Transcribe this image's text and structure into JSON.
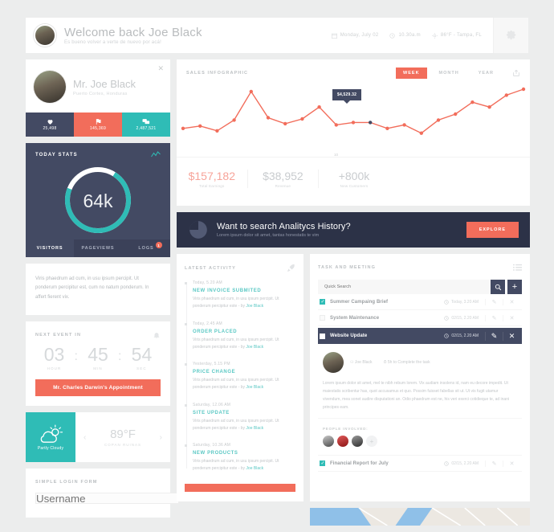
{
  "header": {
    "greeting": "Welcome back Joe Black",
    "subtitle": "Es bueno volver a verte de nuevo por acá!",
    "date": "Monday, July 02",
    "time": "10.30a.m",
    "weather": "86°F - Tampa, FL",
    "settings_icon": "gear-icon"
  },
  "profile": {
    "name": "Mr. Joe Black",
    "location": "Puerto Cortes, Honduras",
    "close_label": "✕",
    "stats": [
      {
        "icon": "heart-icon",
        "value": "25,498",
        "color": "#434a63"
      },
      {
        "icon": "flag-icon",
        "value": "145,369",
        "color": "#f26d5b"
      },
      {
        "icon": "comments-icon",
        "value": "2,487,521",
        "color": "#2fbcb6"
      }
    ]
  },
  "today_stats": {
    "title": "TODAY STATS",
    "chart_icon": "trend-line-icon",
    "donut_value": "64k",
    "donut_percent": 72,
    "donut_color": "#2fbcb6",
    "donut_track": "#ffffff",
    "tabs": [
      {
        "label": "VISITORS",
        "active": true,
        "badge": ""
      },
      {
        "label": "PAGEVIEWS",
        "active": false,
        "badge": ""
      },
      {
        "label": "LOGS",
        "active": false,
        "badge": "1"
      }
    ]
  },
  "description": {
    "text": "Viris phaedrum ad cum, in usu ipsum percipit. Ut ponderum percipitur est, cum no natum ponderum. In affert fierent vix."
  },
  "next_event": {
    "title": "NEXT EVENT IN",
    "icon": "bell-icon",
    "hours": "03",
    "minutes": "45",
    "seconds": "54",
    "separator": ":",
    "labels": {
      "hour": "HOUR",
      "min": "MIN",
      "sec": "SEC"
    },
    "button": "Mr. Charles Darwin's Appointment"
  },
  "weather_widget": {
    "icon": "partly-cloudy-icon",
    "condition": "Partly Cloudy",
    "temperature": "89°F",
    "city": "COPAN RUINAS",
    "prev": "‹",
    "next": "›"
  },
  "login_form": {
    "title": "SIMPLE LOGIN FORM",
    "placeholder": "Username"
  },
  "sales": {
    "title": "SALES INFOGRAPHIC",
    "share_icon": "share-icon",
    "ranges": [
      {
        "label": "WEEK",
        "active": true
      },
      {
        "label": "MONTH",
        "active": false
      },
      {
        "label": "YEAR",
        "active": false
      }
    ],
    "tooltip": "$4,529.32",
    "axis_label": "10",
    "figures": [
      {
        "value": "$157,182",
        "label": "Total Earnings",
        "accent": true
      },
      {
        "value": "$38,952",
        "label": "Revenue",
        "accent": false
      },
      {
        "value": "+800k",
        "label": "New Customers",
        "accent": false
      }
    ]
  },
  "chart_data": {
    "type": "line",
    "title": "SALES INFOGRAPHIC",
    "xlabel": "",
    "ylabel": "",
    "grid": false,
    "legend": "none",
    "series_color": "#f26d5b",
    "highlight_index": 11,
    "highlight_value": "$4,529.32",
    "ylim": [
      0,
      100
    ],
    "x": [
      0,
      1,
      2,
      3,
      4,
      5,
      6,
      7,
      8,
      9,
      10,
      11,
      12,
      13,
      14,
      15,
      16,
      17,
      18,
      19,
      20
    ],
    "values": [
      30,
      34,
      26,
      44,
      92,
      48,
      38,
      46,
      66,
      36,
      40,
      40,
      30,
      36,
      22,
      44,
      54,
      74,
      66,
      86,
      96
    ]
  },
  "banner": {
    "icon": "pie-chart-icon",
    "title": "Want to search Analitycs History?",
    "subtitle": "Lorem ipsum dolor sit amet, tantas honestatis te vim",
    "button": "EXPLORE"
  },
  "activity": {
    "title": "LATEST ACTIVITY",
    "icon": "rocket-icon",
    "items": [
      {
        "time": "Today, 5.20 AM",
        "name": "NEW INVOICE SUBMITED",
        "text": "Viris phaedrum ad cum, in usu ipsum percipit. Ut ponderum percipitur este - by ",
        "author": "Joe Black"
      },
      {
        "time": "Today, 2.45 AM",
        "name": "ORDER PLACED",
        "text": "Viris phaedrum ad cum, in usu ipsum percipit. Ut ponderum percipitur este - by ",
        "author": "Joe Black"
      },
      {
        "time": "Yesterday, 5.15 PM",
        "name": "PRICE CHANGE",
        "text": "Viris phaedrum ad cum, in usu ipsum percipit. Ut ponderum percipitur este - by ",
        "author": "Joe Black"
      },
      {
        "time": "Saturday, 12.06 AM",
        "name": "SITE UPDATE",
        "text": "Viris phaedrum ad cum, in usu ipsum percipit. Ut ponderum percipitur este - by ",
        "author": "Joe Black"
      },
      {
        "time": "Saturday, 10.36 AM",
        "name": "NEW PRODUCTS",
        "text": "Viris phaedrum ad cum, in usu ipsum percipit. Ut ponderum percipitur este - by ",
        "author": "Joe Black"
      }
    ]
  },
  "tasks": {
    "title": "TASK AND MEETING",
    "list_icon": "list-icon",
    "search_placeholder": "Quick Search",
    "search_value": "",
    "search_icon": "search-icon",
    "add_icon": "+",
    "edit_icon": "pencil-icon",
    "delete_icon": "✕",
    "rows": [
      {
        "name": "Summer Campaing Brief",
        "date": "Today, 3.20 AM",
        "checked": true,
        "selected": false
      },
      {
        "name": "System Maintenance",
        "date": "02/15, 2.20 AM",
        "checked": false,
        "selected": false
      },
      {
        "name": "Website Update",
        "date": "02/15, 2.20 AM",
        "checked": false,
        "selected": true
      },
      {
        "name": "Financial Report for July",
        "date": "02/15, 2.20 AM",
        "checked": true,
        "selected": false
      }
    ],
    "detail": {
      "author": "Joe Black",
      "eta": "5h to Complete the task",
      "body": "Lorem ipsum dolor sit amet, mel te nibh rebum lorem. Vix audiam insolens id, nam eu decore impedit. Ut maiestatis scribentur has, quot accusamus et quo. Possim fuisset fabellas sit ut. Ut vis fugit utamur vivendum, mea sonet audire disputationi an. Odio phaedrum est ne, his veri exerci cotidieque te, ad inani principes eam."
    },
    "people": {
      "label": "PEOPLE INVOLVED:",
      "add": "+"
    }
  }
}
